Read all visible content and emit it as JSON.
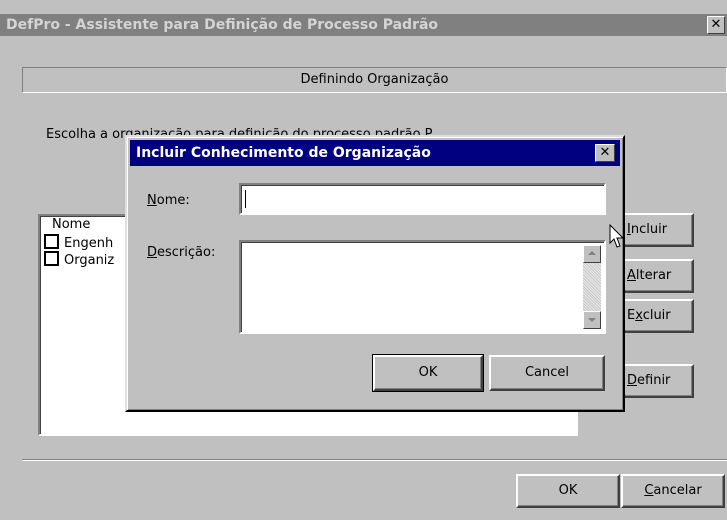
{
  "window": {
    "title": "DefPro - Assistente para Definição de Processo Padrão",
    "close_glyph": "✕"
  },
  "header": {
    "text": "Definindo Organização"
  },
  "instruction": {
    "text": "Escolha a organização para definição do processo padrão P..."
  },
  "list": {
    "column_header": "Nome",
    "rows": [
      {
        "label": "Engenh"
      },
      {
        "label": "Organiz"
      }
    ]
  },
  "side_buttons": {
    "incluir": {
      "pre": "",
      "mnemonic": "I",
      "post": "ncluir"
    },
    "alterar": {
      "pre": "",
      "mnemonic": "A",
      "post": "lterar"
    },
    "excluir": {
      "pre": "E",
      "mnemonic": "x",
      "post": "cluir"
    },
    "definir": {
      "pre": "",
      "mnemonic": "D",
      "post": "efinir"
    }
  },
  "bottom_buttons": {
    "ok": "OK",
    "cancelar": {
      "mnemonic": "C",
      "post": "ancelar"
    }
  },
  "dialog": {
    "title": "Incluir Conhecimento de Organização",
    "close_glyph": "✕",
    "nome_label": {
      "mnemonic": "N",
      "post": "ome:"
    },
    "nome_value": "",
    "descricao_label": {
      "mnemonic": "D",
      "post": "escrição:"
    },
    "descricao_value": "",
    "ok_label": "OK",
    "cancel_label": "Cancel"
  },
  "colors": {
    "face": "#c0c0c0",
    "inactive_title": "#808080",
    "active_title": "#000080"
  }
}
